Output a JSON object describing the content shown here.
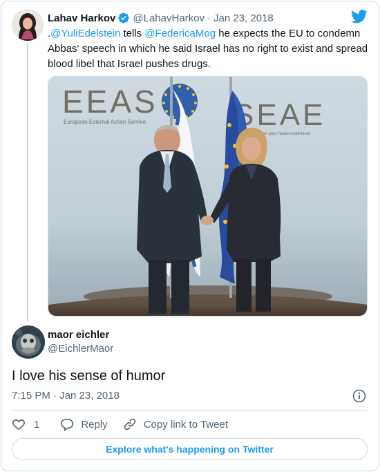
{
  "parent_tweet": {
    "author_name": "Lahav Harkov",
    "handle": "@LahavHarkov",
    "separator": "·",
    "date": "Jan 23, 2018",
    "text_prefix": ".",
    "mention_1": "@YuliEdelstein",
    "text_middle": " tells ",
    "mention_2": "@FedericaMog",
    "text_rest": " he expects the EU to condemn Abbas' speech in which he said Israel has no right to exist and spread blood libel that Israel pushes drugs.",
    "photo": {
      "wall_text_left": "EEAS",
      "wall_subtext_left": "European External Action Service",
      "wall_text_right": "SEAE",
      "wall_subtext_right": "Service européen pour l'action extérieure"
    }
  },
  "reply_tweet": {
    "author_name": "maor eichler",
    "handle": "@EichlerMaor",
    "text": "I love his sense of humor",
    "timestamp": "7:15 PM · Jan 23, 2018"
  },
  "actions": {
    "like_count": "1",
    "reply_label": "Reply",
    "copy_link_label": "Copy link to Tweet"
  },
  "explore_label": "Explore what's happening on Twitter",
  "icons": {
    "twitter": "twitter-bird-icon",
    "verified": "verified-badge-icon",
    "info": "info-icon",
    "like": "heart-icon",
    "reply": "reply-bubble-icon",
    "copy_link": "link-icon"
  },
  "colors": {
    "accent": "#1d9bf0",
    "text": "#0f1419",
    "secondary_text": "#536471",
    "border": "#cfd9de"
  }
}
